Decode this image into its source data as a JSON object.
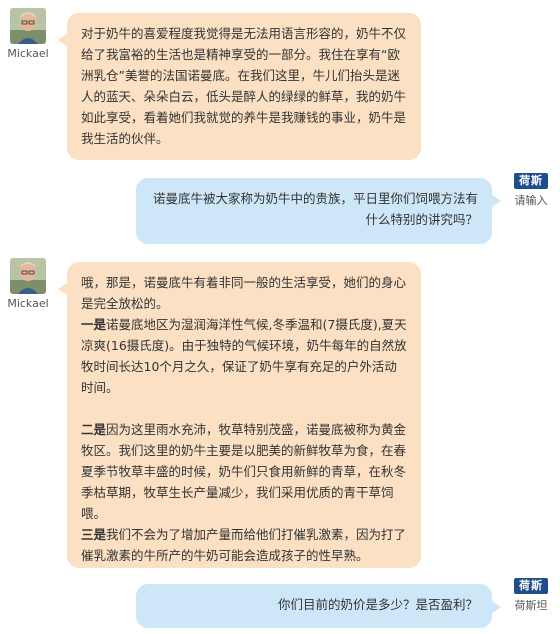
{
  "messages": [
    {
      "sender": "Mickael",
      "side": "left",
      "paragraphs": [
        {
          "lead": "",
          "text": "对于奶牛的喜爱程度我觉得是无法用语言形容的，奶牛不仅给了我富裕的生活也是精神享受的一部分。我住在享有“欧洲乳仓”美誉的法国诺曼底。在我们这里，牛儿们抬头是迷人的蓝天、朵朵白云，低头是醉人的绿绿的鲜草，我的奶牛如此享受，看着她们我就觉的养牛是我赚钱的事业，奶牛是我生活的伙伴。"
        }
      ]
    },
    {
      "sender": "请输入",
      "logo_text": "荷斯坦",
      "side": "right",
      "paragraphs": [
        {
          "lead": "",
          "text": "诺曼底牛被大家称为奶牛中的贵族，平日里你们饲喂方法有什么特别的讲究吗？"
        }
      ]
    },
    {
      "sender": "Mickael",
      "side": "left",
      "paragraphs": [
        {
          "lead": "",
          "text": "哦，那是，诺曼底牛有着非同一般的生活享受，她们的身心是完全放松的。"
        },
        {
          "lead": "一是",
          "text": "诺曼底地区为湿润海洋性气候,冬季温和(7摄氏度),夏天凉爽(16摄氏度)。由于独特的气候环境，奶牛每年的自然放牧时间长达10个月之久，保证了奶牛享有充足的户外活动时间。"
        },
        {
          "lead": "",
          "text": ""
        },
        {
          "lead": "二是",
          "text": "因为这里雨水充沛，牧草特别茂盛，诺曼底被称为黄金牧区。我们这里的奶牛主要是以肥美的新鲜牧草为食，在春夏季节牧草丰盛的时候，奶牛们只食用新鲜的青草，在秋冬季枯草期，牧草生长产量减少，我们采用优质的青干草饲喂。"
        },
        {
          "lead": "三是",
          "text": "我们不会为了增加产量而给他们打催乳激素，因为打了催乳激素的牛所产的牛奶可能会造成孩子的性早熟。"
        }
      ]
    },
    {
      "sender": "荷斯坦",
      "logo_text": "荷斯坦",
      "side": "right",
      "paragraphs": [
        {
          "lead": "",
          "text": "你们目前的奶价是多少？是否盈利？"
        }
      ]
    }
  ]
}
